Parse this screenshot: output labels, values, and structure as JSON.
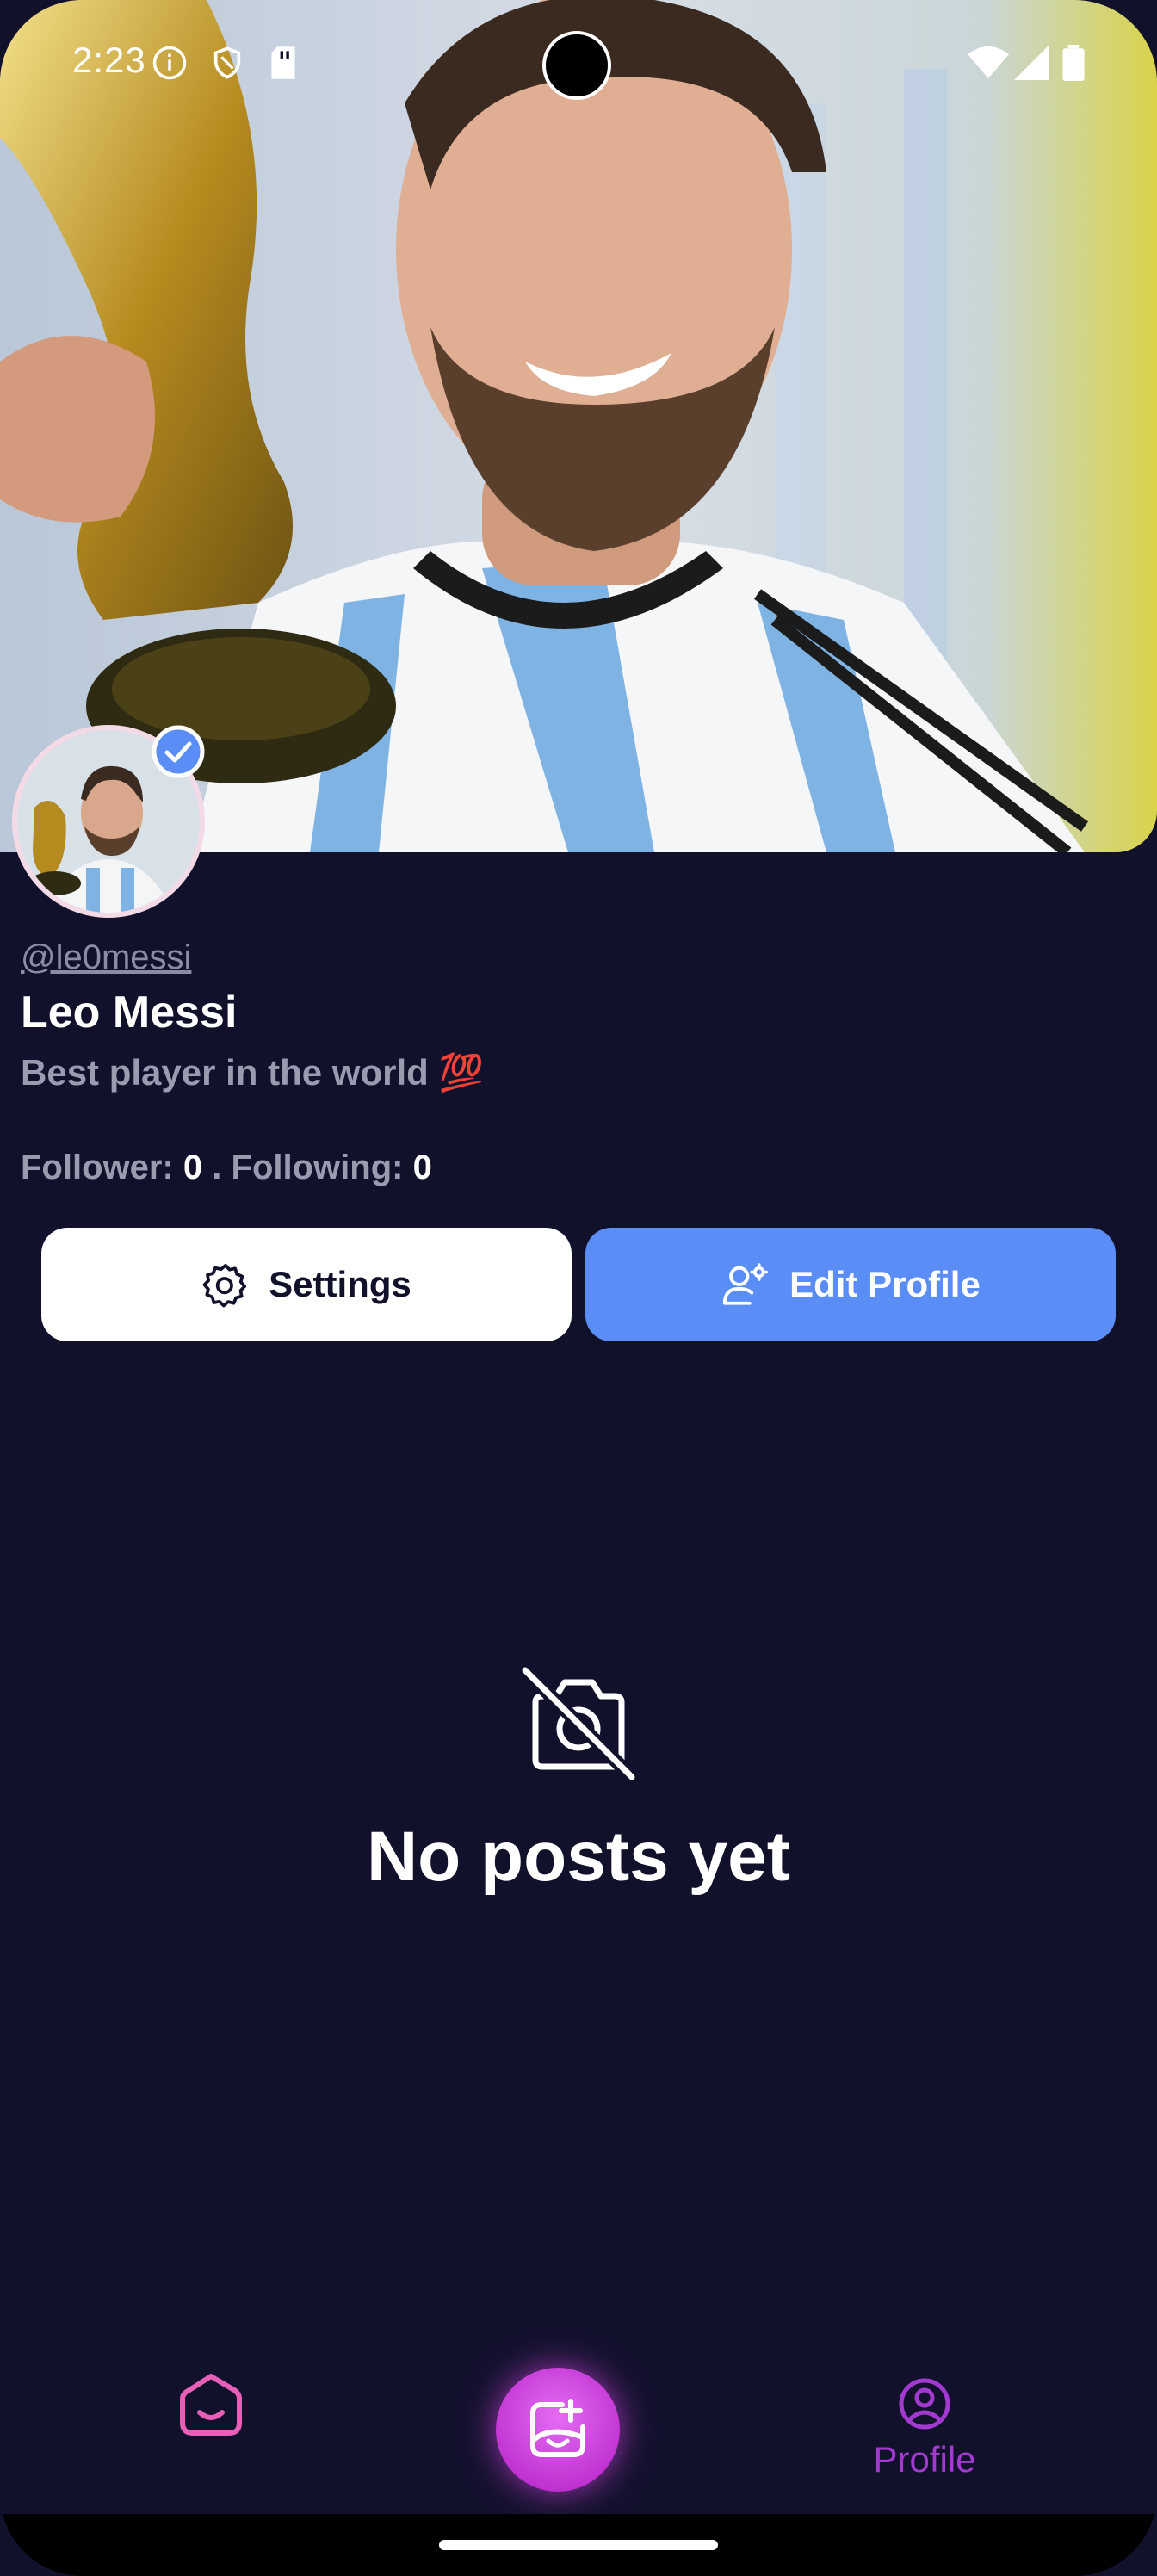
{
  "status_bar": {
    "time": "2:23"
  },
  "profile": {
    "handle": "@le0messi",
    "name": "Leo Messi",
    "bio": "Best player in the world 💯",
    "follower_label": "Follower:",
    "follower_count": "0",
    "separator": ".",
    "following_label": "Following:",
    "following_count": "0"
  },
  "actions": {
    "settings_label": "Settings",
    "edit_label": "Edit Profile"
  },
  "empty_state": {
    "text": "No posts yet"
  },
  "nav": {
    "profile_label": "Profile"
  },
  "colors": {
    "background": "#12112c",
    "accent_blue": "#5b8df7",
    "accent_purple": "#a23ad0"
  },
  "icons": [
    "info-icon",
    "shield-icon",
    "sd-card-icon",
    "wifi-icon",
    "signal-icon",
    "battery-icon",
    "verified-icon",
    "gear-icon",
    "user-gear-icon",
    "no-camera-icon",
    "home-icon",
    "add-photo-icon",
    "profile-icon"
  ]
}
